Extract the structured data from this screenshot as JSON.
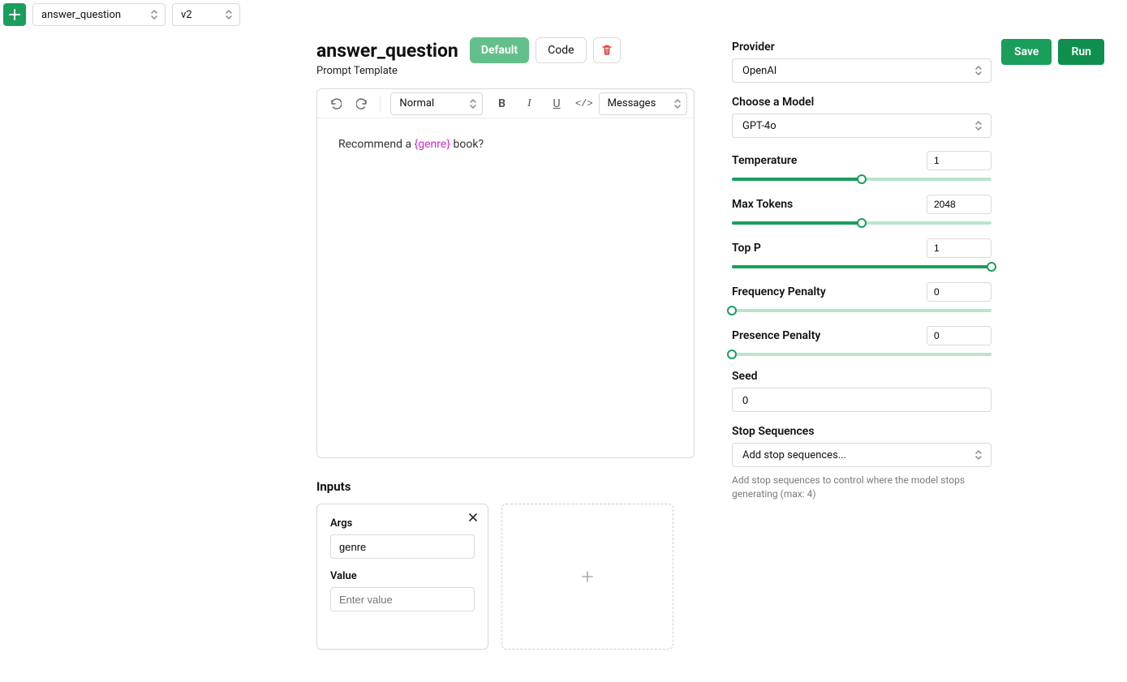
{
  "topbar": {
    "template_select": "answer_question",
    "version_select": "v2"
  },
  "header": {
    "title": "answer_question",
    "default_label": "Default",
    "code_label": "Code"
  },
  "subheader": "Prompt Template",
  "editor_toolbar": {
    "normal_select": "Normal",
    "messages_select": "Messages"
  },
  "editor": {
    "text_before": "Recommend a ",
    "variable": "{genre}",
    "text_after": " book?"
  },
  "inputs": {
    "section_label": "Inputs",
    "card": {
      "args_label": "Args",
      "args_value": "genre",
      "value_label": "Value",
      "value_placeholder": "Enter value"
    }
  },
  "actions": {
    "save": "Save",
    "run": "Run"
  },
  "settings": {
    "provider_label": "Provider",
    "provider_value": "OpenAI",
    "model_label": "Choose a Model",
    "model_value": "GPT-4o",
    "temperature_label": "Temperature",
    "temperature_value": "1",
    "temperature_pct": 50,
    "max_tokens_label": "Max Tokens",
    "max_tokens_value": "2048",
    "max_tokens_pct": 50,
    "top_p_label": "Top P",
    "top_p_value": "1",
    "top_p_pct": 100,
    "freq_penalty_label": "Frequency Penalty",
    "freq_penalty_value": "0",
    "freq_penalty_pct": 0,
    "pres_penalty_label": "Presence Penalty",
    "pres_penalty_value": "0",
    "pres_penalty_pct": 0,
    "seed_label": "Seed",
    "seed_value": "0",
    "stop_label": "Stop Sequences",
    "stop_placeholder": "Add stop sequences...",
    "stop_hint": "Add stop sequences to control where the model stops generating (max: 4)"
  }
}
